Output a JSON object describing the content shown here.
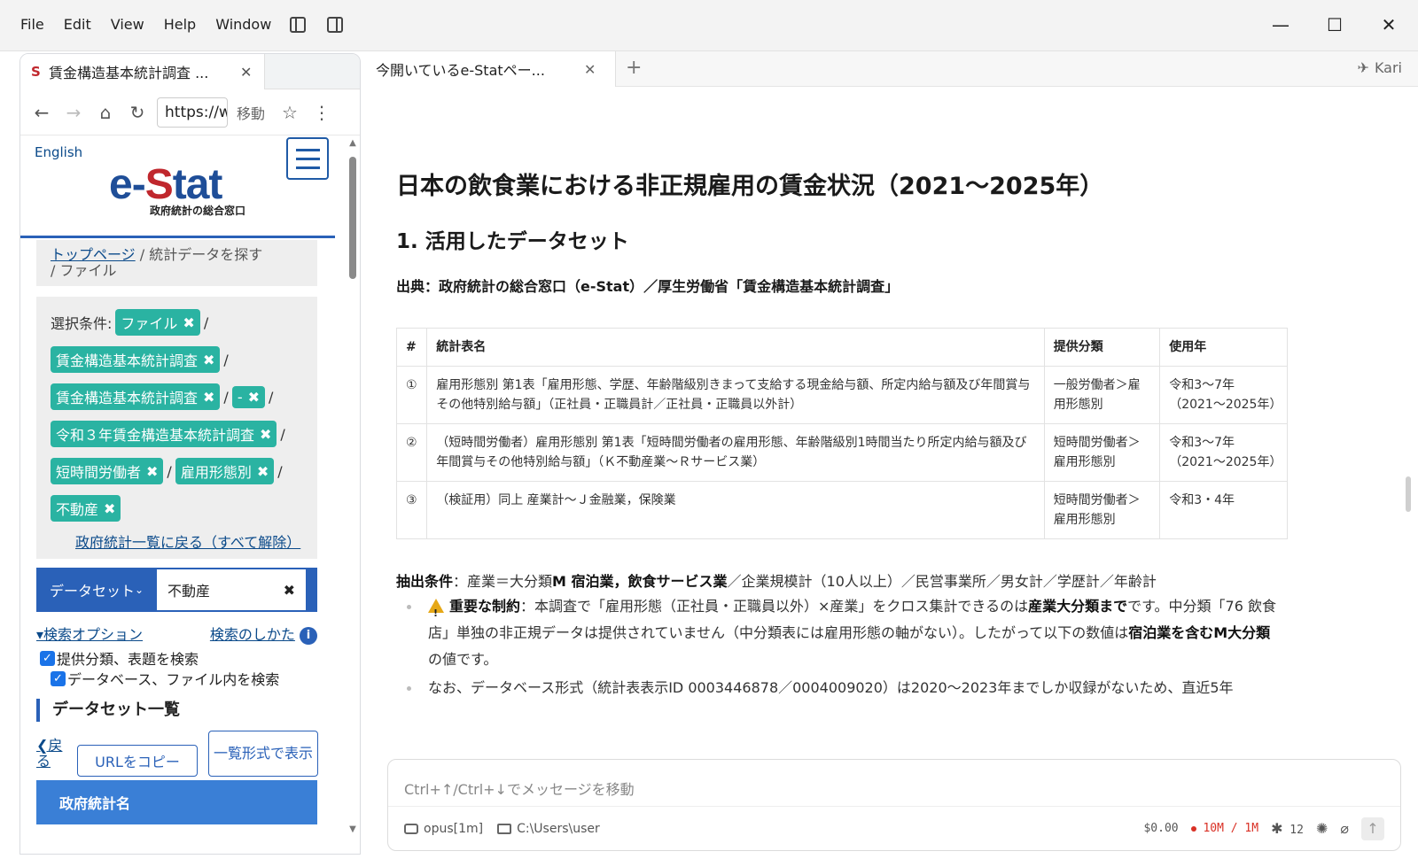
{
  "menu": {
    "file": "File",
    "edit": "Edit",
    "view": "View",
    "help": "Help",
    "window": "Window"
  },
  "window_controls": {
    "minimize": "—",
    "maximize": "☐",
    "close": "✕"
  },
  "left_browser": {
    "tab_title": "賃金構造基本統計調査 ...",
    "favicon": "S",
    "url": "https://w",
    "go_label": "移動",
    "english_link": "English",
    "logo_prefix": "e-",
    "logo_s": "S",
    "logo_suffix": "tat",
    "logo_sub": "政府統計の総合窓口",
    "breadcrumb": {
      "home": "トップページ",
      "sep1": " / ",
      "search": "統計データを探す",
      "sep2": " / ",
      "file": "ファイル"
    },
    "conditions": {
      "label": "選択条件:",
      "chips": {
        "c1": "ファイル",
        "c2": "賃金構造基本統計調査",
        "c3": "賃金構造基本統計調査",
        "c4": "-",
        "c5": "令和３年賃金構造基本統計調査",
        "c6": "短時間労働者",
        "c7": "雇用形態別",
        "c8": "不動産"
      },
      "reset_link": "政府統計一覧に戻る（すべて解除）"
    },
    "search": {
      "type": "データセット",
      "value": "不動産",
      "options_link": "検索オプション",
      "howto_link": "検索のしかた",
      "check1": "提供分類、表題を検索",
      "check2": "データベース、ファイル内を検索"
    },
    "dataset_heading": "データセット一覧",
    "back_link": "戻る",
    "url_copy_button": "URLをコピー",
    "list_view_button": "一覧形式で表示",
    "table_header": "政府統計名"
  },
  "right_tab": {
    "title": "今開いているe-Statペー...",
    "add": "+",
    "user": "Kari"
  },
  "doc": {
    "title": "日本の飲食業における非正規雇用の賃金状況（2021〜2025年）",
    "h2": "1. 活用したデータセット",
    "source": "出典：政府統計の総合窓口（e-Stat）／厚生労働省「賃金構造基本統計調査」",
    "table": {
      "headers": {
        "num": "#",
        "name": "統計表名",
        "category": "提供分類",
        "year": "使用年"
      },
      "rows": [
        {
          "num": "①",
          "name": "雇用形態別 第1表「雇用形態、学歴、年齢階級別きまって支給する現金給与額、所定内給与額及び年間賞与その他特別給与額」（正社員・正職員計／正社員・正職員以外計）",
          "category": "一般労働者＞雇用形態別",
          "year": "令和3〜7年（2021〜2025年）"
        },
        {
          "num": "②",
          "name": "（短時間労働者）雇用形態別 第1表「短時間労働者の雇用形態、年齢階級別1時間当たり所定内給与額及び年間賞与その他特別給与額」（Ｋ不動産業〜Ｒサービス業）",
          "category": "短時間労働者＞雇用形態別",
          "year": "令和3〜7年（2021〜2025年）"
        },
        {
          "num": "③",
          "name": "（検証用）同上 産業計〜Ｊ金融業，保険業",
          "category": "短時間労働者＞雇用形態別",
          "year": "令和3・4年"
        }
      ]
    },
    "extract_label": "抽出条件",
    "extract_pre": "：産業＝大分類",
    "extract_bold": "M 宿泊業，飲食サービス業",
    "extract_post": "／企業規模計（10人以上）／民営事業所／男女計／学歴計／年齢計",
    "bullet1": {
      "label": "重要な制約",
      "t1": "：本調査で「雇用形態（正社員・正職員以外）×産業」をクロス集計できるのは",
      "b1": "産業大分類まで",
      "t2": "です。中分類「76 飲食店」単独の非正規データは提供されていません（中分類表には雇用形態の軸がない）。したがって以下の数値は",
      "b2": "宿泊業を含むM大分類",
      "t3": "の値です。"
    },
    "bullet2": "なお、データベース形式（統計表表示ID 0003446878／0004009020）は2020〜2023年までしか収録がないため、直近5年"
  },
  "chat": {
    "placeholder": "Ctrl+↑/Ctrl+↓でメッセージを移動",
    "model": "opus[1m]",
    "path": "C:\\Users\\user",
    "cost": "$0.00",
    "tokens": "10M / 1M",
    "plugins": "12"
  }
}
